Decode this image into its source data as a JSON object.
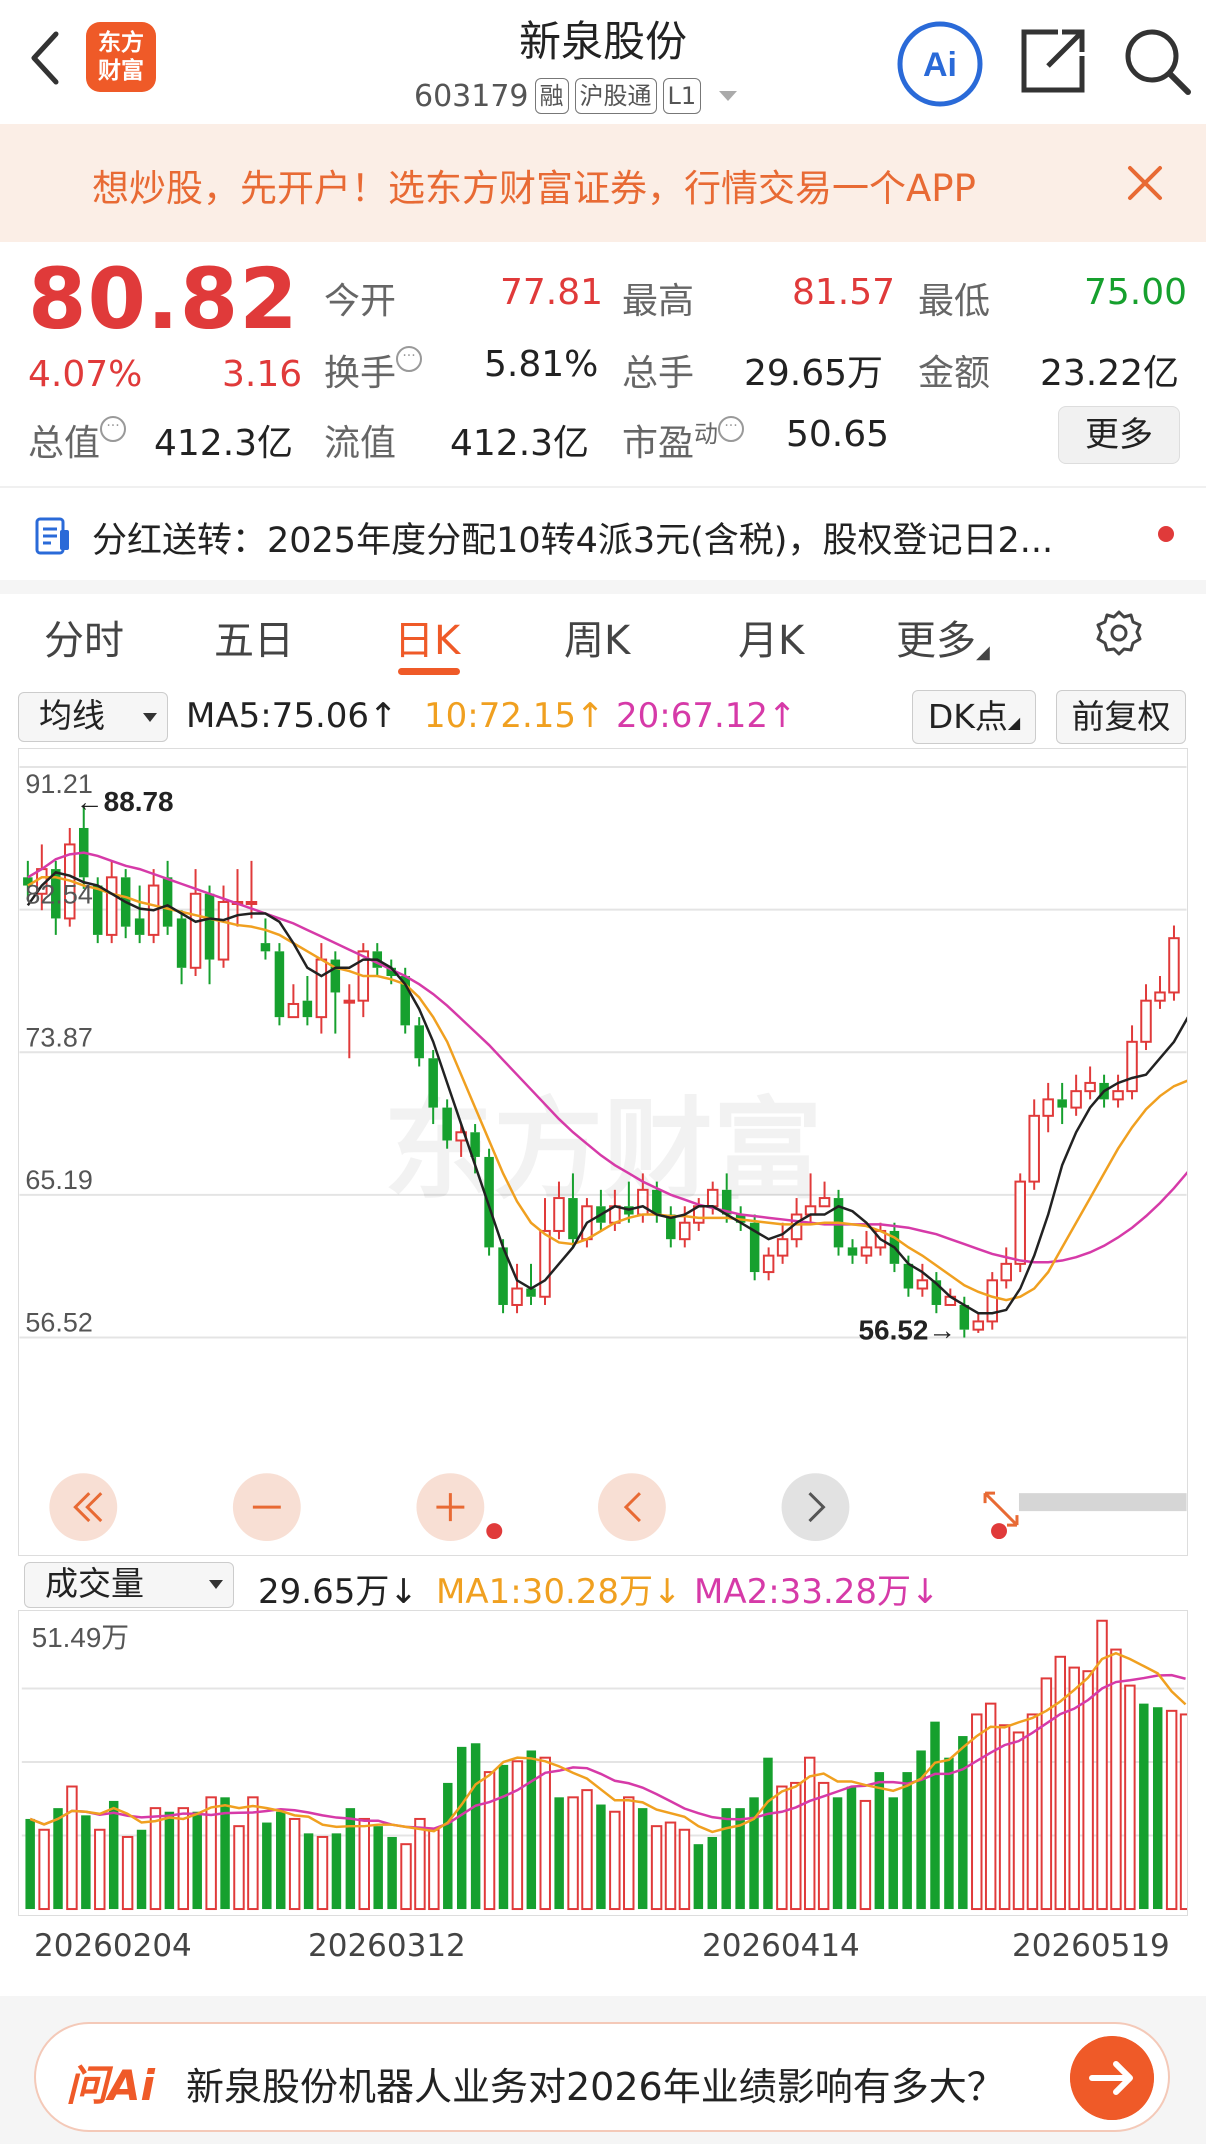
{
  "header": {
    "logo_line1": "东方",
    "logo_line2": "财富",
    "title": "新泉股份",
    "code": "603179",
    "tags": [
      "融",
      "沪股通",
      "L1"
    ],
    "ai_label": "Ai"
  },
  "promo": {
    "text": "想炒股，先开户！选东方财富证券，行情交易一个APP"
  },
  "quote": {
    "price": "80.82",
    "change_pct": "4.07%",
    "change": "3.16",
    "open_label": "今开",
    "open": "77.81",
    "high_label": "最高",
    "high": "81.57",
    "low_label": "最低",
    "low": "75.00",
    "turnover_label": "换手",
    "turnover": "5.81%",
    "volume_label": "总手",
    "volume": "29.65万",
    "amount_label": "金额",
    "amount": "23.22亿",
    "mktcap_label": "总值",
    "mktcap": "412.3亿",
    "float_label": "流值",
    "float": "412.3亿",
    "pe_label": "市盈",
    "pe_sup": "动",
    "pe": "50.65",
    "more": "更多"
  },
  "notice": {
    "text": "分红送转：2025年度分配10转4派3元(含税)，股权登记日2..."
  },
  "tabs": {
    "items": [
      "分时",
      "五日",
      "日K",
      "周K",
      "月K",
      "更多"
    ],
    "active": 2
  },
  "indicators": {
    "ma_select": "均线",
    "ma5": "MA5:75.06↑",
    "ma10": "10:72.15↑",
    "ma20": "20:67.12↑",
    "dk": "DK点",
    "fq": "前复权",
    "ma5_color": "#222222",
    "ma10_color": "#f0a020",
    "ma20_color": "#d63aa8"
  },
  "price_axis": [
    "91.21",
    "82.54",
    "73.87",
    "65.19",
    "56.52"
  ],
  "annotations": {
    "max": "←88.78",
    "min": "56.52→"
  },
  "watermark": "东方财富",
  "volume_panel": {
    "select": "成交量",
    "value": "29.65万↓",
    "ma1": "MA1:30.28万↓",
    "ma2": "MA2:33.28万↓",
    "max_label": "51.49万"
  },
  "dates": [
    "20260204",
    "20260312",
    "20260414",
    "20260519"
  ],
  "bottom": {
    "logo": "问Ai",
    "question": "新泉股份机器人业务对2026年业绩影响有多大？"
  },
  "chart_data": {
    "type": "candlestick",
    "ylim": [
      56.52,
      91.21
    ],
    "candles": [
      [
        84.5,
        84.0,
        85.5,
        83.2
      ],
      [
        83.5,
        85.0,
        86.5,
        82.5
      ],
      [
        85.0,
        82.0,
        85.5,
        81.0
      ],
      [
        82.0,
        86.5,
        87.5,
        81.5
      ],
      [
        87.5,
        84.5,
        88.78,
        83.8
      ],
      [
        84.0,
        81.0,
        84.5,
        80.5
      ],
      [
        81.0,
        84.5,
        85.5,
        80.5
      ],
      [
        84.5,
        81.5,
        85.0,
        80.8
      ],
      [
        82.0,
        81.0,
        84.0,
        80.5
      ],
      [
        81.0,
        84.0,
        85.0,
        80.5
      ],
      [
        84.5,
        81.5,
        85.5,
        81.0
      ],
      [
        82.0,
        79.0,
        82.5,
        78.0
      ],
      [
        79.0,
        83.5,
        85.0,
        78.5
      ],
      [
        83.5,
        79.5,
        84.0,
        78.0
      ],
      [
        79.5,
        83.0,
        84.0,
        79.0
      ],
      [
        83.0,
        83.0,
        85.0,
        81.5
      ],
      [
        83.0,
        83.0,
        85.5,
        82.0
      ],
      [
        80.5,
        80.0,
        82.0,
        79.5
      ],
      [
        80.0,
        76.0,
        80.5,
        75.5
      ],
      [
        76.0,
        76.8,
        78.0,
        76.0
      ],
      [
        77.0,
        76.0,
        78.5,
        75.5
      ],
      [
        76.0,
        79.5,
        80.5,
        75.0
      ],
      [
        79.5,
        77.5,
        80.0,
        75.0
      ],
      [
        77.0,
        77.0,
        78.0,
        73.5
      ],
      [
        77.0,
        80.0,
        80.5,
        76.0
      ],
      [
        80.0,
        79.0,
        80.5,
        78.5
      ],
      [
        79.0,
        78.5,
        79.5,
        78.0
      ],
      [
        78.5,
        75.5,
        79.0,
        75.0
      ],
      [
        75.5,
        73.5,
        76.0,
        73.0
      ],
      [
        73.5,
        70.5,
        74.0,
        69.5
      ],
      [
        70.5,
        68.5,
        71.0,
        68.0
      ],
      [
        68.5,
        69.0,
        69.5,
        67.5
      ],
      [
        69.0,
        67.5,
        69.5,
        66.5
      ],
      [
        67.5,
        62.0,
        68.0,
        61.5
      ],
      [
        62.0,
        58.5,
        62.5,
        58.0
      ],
      [
        58.5,
        59.5,
        61.0,
        58.0
      ],
      [
        59.5,
        59.0,
        61.0,
        58.5
      ],
      [
        59.0,
        63.0,
        65.0,
        58.5
      ],
      [
        63.0,
        65.0,
        66.0,
        62.5
      ],
      [
        65.0,
        62.5,
        66.5,
        62.0
      ],
      [
        62.5,
        64.5,
        65.0,
        62.0
      ],
      [
        64.5,
        63.5,
        65.5,
        63.0
      ],
      [
        63.5,
        64.5,
        65.5,
        63.0
      ],
      [
        64.5,
        64.0,
        66.0,
        63.5
      ],
      [
        64.0,
        65.5,
        66.5,
        63.5
      ],
      [
        65.5,
        64.0,
        66.0,
        63.5
      ],
      [
        64.0,
        62.5,
        64.5,
        62.0
      ],
      [
        62.5,
        63.5,
        64.5,
        62.0
      ],
      [
        63.5,
        64.5,
        65.0,
        63.0
      ],
      [
        64.5,
        65.5,
        66.0,
        64.0
      ],
      [
        65.5,
        64.0,
        66.5,
        63.5
      ],
      [
        64.0,
        63.5,
        64.5,
        63.0
      ],
      [
        63.5,
        60.5,
        64.0,
        60.0
      ],
      [
        60.5,
        61.5,
        62.0,
        60.0
      ],
      [
        61.5,
        62.5,
        63.5,
        61.0
      ],
      [
        62.5,
        64.0,
        65.0,
        62.0
      ],
      [
        64.0,
        64.5,
        66.5,
        63.5
      ],
      [
        64.5,
        65.0,
        66.0,
        64.5
      ],
      [
        65.0,
        62.0,
        65.5,
        61.5
      ],
      [
        62.0,
        61.5,
        62.5,
        61.0
      ],
      [
        61.5,
        62.0,
        63.0,
        61.0
      ],
      [
        62.0,
        63.0,
        63.5,
        61.5
      ],
      [
        63.0,
        61.0,
        63.5,
        60.5
      ],
      [
        61.0,
        59.5,
        61.5,
        59.0
      ],
      [
        59.5,
        60.0,
        61.0,
        59.0
      ],
      [
        60.0,
        58.5,
        60.5,
        58.0
      ],
      [
        58.5,
        59.0,
        59.5,
        58.5
      ],
      [
        58.5,
        57.0,
        59.0,
        56.52
      ],
      [
        57.0,
        57.5,
        58.0,
        56.8
      ],
      [
        57.5,
        60.0,
        60.5,
        57.0
      ],
      [
        60.0,
        61.0,
        62.0,
        59.5
      ],
      [
        61.0,
        66.0,
        66.5,
        60.5
      ],
      [
        66.0,
        70.0,
        71.0,
        65.5
      ],
      [
        70.0,
        71.0,
        72.0,
        69.0
      ],
      [
        71.0,
        70.5,
        72.0,
        69.5
      ],
      [
        70.5,
        71.5,
        72.5,
        70.0
      ],
      [
        71.5,
        72.0,
        73.0,
        71.0
      ],
      [
        72.0,
        71.0,
        72.5,
        70.5
      ],
      [
        71.0,
        71.5,
        72.5,
        70.5
      ],
      [
        71.5,
        74.5,
        75.5,
        71.0
      ],
      [
        74.5,
        77.0,
        78.0,
        74.0
      ],
      [
        77.0,
        77.5,
        78.5,
        76.5
      ],
      [
        77.5,
        80.8,
        81.57,
        77.0
      ]
    ],
    "volume": [
      [
        25,
        "d"
      ],
      [
        22,
        "u"
      ],
      [
        28,
        "d"
      ],
      [
        34,
        "u"
      ],
      [
        26,
        "d"
      ],
      [
        22,
        "u"
      ],
      [
        30,
        "d"
      ],
      [
        20,
        "u"
      ],
      [
        22,
        "d"
      ],
      [
        28,
        "u"
      ],
      [
        27,
        "d"
      ],
      [
        28,
        "u"
      ],
      [
        27,
        "d"
      ],
      [
        31,
        "u"
      ],
      [
        31,
        "d"
      ],
      [
        23,
        "u"
      ],
      [
        31,
        "u"
      ],
      [
        24,
        "d"
      ],
      [
        27,
        "d"
      ],
      [
        25,
        "u"
      ],
      [
        21,
        "d"
      ],
      [
        20,
        "u"
      ],
      [
        21,
        "d"
      ],
      [
        28,
        "d"
      ],
      [
        25,
        "u"
      ],
      [
        23,
        "d"
      ],
      [
        20,
        "d"
      ],
      [
        18,
        "u"
      ],
      [
        25,
        "u"
      ],
      [
        22,
        "u"
      ],
      [
        35,
        "d"
      ],
      [
        45,
        "d"
      ],
      [
        46,
        "d"
      ],
      [
        38,
        "u"
      ],
      [
        40,
        "d"
      ],
      [
        41,
        "u"
      ],
      [
        44,
        "d"
      ],
      [
        42,
        "u"
      ],
      [
        31,
        "d"
      ],
      [
        31,
        "u"
      ],
      [
        33,
        "u"
      ],
      [
        29,
        "d"
      ],
      [
        27,
        "u"
      ],
      [
        31,
        "u"
      ],
      [
        28,
        "d"
      ],
      [
        23,
        "u"
      ],
      [
        24,
        "u"
      ],
      [
        22,
        "u"
      ],
      [
        18,
        "d"
      ],
      [
        20,
        "d"
      ],
      [
        28,
        "d"
      ],
      [
        28,
        "d"
      ],
      [
        31,
        "d"
      ],
      [
        42,
        "d"
      ],
      [
        34,
        "u"
      ],
      [
        35,
        "u"
      ],
      [
        42,
        "u"
      ],
      [
        35,
        "u"
      ],
      [
        31,
        "d"
      ],
      [
        34,
        "d"
      ],
      [
        30,
        "u"
      ],
      [
        38,
        "d"
      ],
      [
        31,
        "d"
      ],
      [
        38,
        "d"
      ],
      [
        44,
        "d"
      ],
      [
        52,
        "d"
      ],
      [
        42,
        "d"
      ],
      [
        48,
        "d"
      ],
      [
        54,
        "u"
      ],
      [
        57,
        "u"
      ],
      [
        51,
        "u"
      ],
      [
        49,
        "u"
      ],
      [
        54,
        "u"
      ],
      [
        64,
        "u"
      ],
      [
        70,
        "u"
      ],
      [
        67,
        "u"
      ],
      [
        66,
        "u"
      ],
      [
        80,
        "u"
      ],
      [
        72,
        "u"
      ],
      [
        62,
        "u"
      ],
      [
        57,
        "d"
      ],
      [
        56,
        "d"
      ],
      [
        55,
        "u"
      ],
      [
        54,
        "u"
      ]
    ],
    "ma5": [
      82.8,
      84.0,
      84.8,
      84.6,
      84.2,
      84.0,
      83.5,
      83.0,
      82.6,
      82.5,
      82.8,
      82.3,
      81.8,
      82.0,
      81.9,
      82.2,
      82.3,
      82.3,
      81.8,
      80.5,
      79.0,
      78.5,
      79.0,
      79.0,
      79.5,
      79.5,
      79.0,
      78.0,
      76.5,
      74.5,
      72.0,
      69.5,
      67.0,
      64.5,
      62.0,
      60.0,
      59.5,
      60.0,
      61.0,
      62.0,
      63.5,
      64.0,
      64.5,
      64.3,
      64.5,
      64.0,
      63.8,
      64.0,
      64.5,
      64.5,
      64.0,
      63.5,
      63.0,
      62.5,
      62.8,
      63.5,
      64.0,
      64.0,
      64.5,
      64.2,
      63.5,
      62.5,
      62.0,
      61.0,
      60.5,
      59.8,
      59.0,
      58.5,
      58.0,
      58.0,
      58.2,
      59.5,
      61.5,
      64.0,
      67.0,
      69.0,
      70.5,
      71.5,
      72.0,
      72.3,
      72.5,
      73.5,
      74.5,
      76.0
    ],
    "ma10": [
      84.0,
      84.5,
      84.5,
      84.3,
      84.0,
      83.8,
      83.5,
      83.3,
      83.0,
      82.8,
      82.6,
      82.4,
      82.2,
      82.0,
      81.8,
      81.6,
      81.5,
      81.3,
      81.0,
      80.5,
      80.0,
      79.5,
      79.0,
      78.8,
      78.5,
      78.5,
      78.3,
      78.0,
      77.2,
      76.0,
      74.5,
      72.5,
      70.5,
      68.5,
      66.5,
      64.8,
      63.5,
      62.8,
      62.3,
      62.2,
      62.5,
      63.0,
      63.5,
      63.8,
      64.0,
      64.0,
      63.9,
      63.9,
      63.8,
      63.8,
      63.8,
      63.7,
      63.6,
      63.5,
      63.4,
      63.4,
      63.4,
      63.5,
      63.5,
      63.4,
      63.3,
      63.0,
      62.6,
      62.0,
      61.5,
      60.9,
      60.3,
      59.7,
      59.3,
      59.0,
      58.8,
      59.0,
      59.5,
      60.5,
      62.0,
      63.5,
      65.0,
      66.5,
      68.0,
      69.3,
      70.4,
      71.2,
      71.8,
      72.15
    ],
    "ma20": [
      84.5,
      85.0,
      85.6,
      85.9,
      86.0,
      85.8,
      85.5,
      85.2,
      85.0,
      84.7,
      84.4,
      84.1,
      83.8,
      83.5,
      83.2,
      82.9,
      82.6,
      82.3,
      82.0,
      81.7,
      81.3,
      80.9,
      80.5,
      80.1,
      79.7,
      79.3,
      78.9,
      78.5,
      78.0,
      77.4,
      76.7,
      75.9,
      75.1,
      74.3,
      73.4,
      72.5,
      71.6,
      70.7,
      69.8,
      69.0,
      68.3,
      67.6,
      67.0,
      66.5,
      66.0,
      65.6,
      65.2,
      64.9,
      64.6,
      64.4,
      64.2,
      64.0,
      63.9,
      63.8,
      63.7,
      63.6,
      63.5,
      63.4,
      63.4,
      63.4,
      63.4,
      63.4,
      63.3,
      63.2,
      63.0,
      62.8,
      62.5,
      62.2,
      61.9,
      61.6,
      61.4,
      61.2,
      61.1,
      61.1,
      61.2,
      61.4,
      61.7,
      62.1,
      62.6,
      63.2,
      63.9,
      64.7,
      65.6,
      66.6
    ]
  }
}
